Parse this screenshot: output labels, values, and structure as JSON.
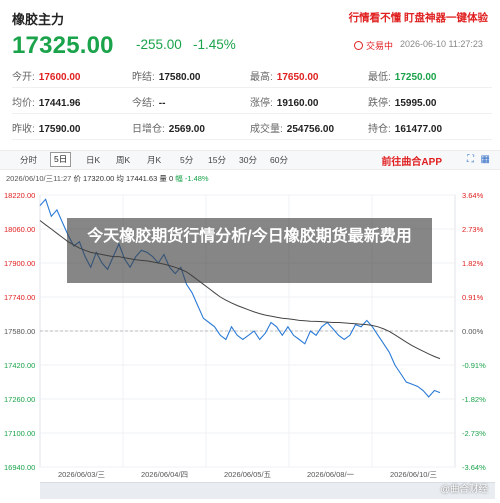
{
  "header": {
    "title": "橡胶主力",
    "promo": "行情看不懂 盯盘神器一键体验",
    "price": "17325.00",
    "change": "-255.00",
    "change_pct": "-1.45%",
    "status_label": "交易中",
    "status_time": "2026-06-10 11:27:23"
  },
  "stats": [
    [
      {
        "label": "今开:",
        "value": "17600.00",
        "color": "red"
      },
      {
        "label": "昨结:",
        "value": "17580.00",
        "color": "dark"
      },
      {
        "label": "最高:",
        "value": "17650.00",
        "color": "red"
      },
      {
        "label": "最低:",
        "value": "17250.00",
        "color": "green"
      }
    ],
    [
      {
        "label": "均价:",
        "value": "17441.96",
        "color": "dark"
      },
      {
        "label": "今结:",
        "value": "--",
        "color": "dark"
      },
      {
        "label": "涨停:",
        "value": "19160.00",
        "color": "dark"
      },
      {
        "label": "跌停:",
        "value": "15995.00",
        "color": "dark"
      }
    ],
    [
      {
        "label": "昨收:",
        "value": "17590.00",
        "color": "dark"
      },
      {
        "label": "日增仓:",
        "value": "2569.00",
        "color": "dark"
      },
      {
        "label": "成交量:",
        "value": "254756.00",
        "color": "dark"
      },
      {
        "label": "持仓:",
        "value": "161477.00",
        "color": "dark"
      }
    ]
  ],
  "tabs": [
    "分时",
    "5日",
    "日K",
    "周K",
    "月K",
    "5分",
    "15分",
    "30分",
    "60分"
  ],
  "active_tab": "5日",
  "tab_app": "前往曲合APP",
  "tab_icons": [
    "expand-icon",
    "grid-icon"
  ],
  "info_bar": {
    "datetime": "2026/06/10/三11:27",
    "price": "价 17320.00",
    "avg": "均 17441.63",
    "change": "量 0",
    "pct": "幅 -1.48%"
  },
  "overlay_text": "今天橡胶期货行情分析/今日橡胶期货最新费用",
  "watermark": "@曲合财经",
  "colors": {
    "up": "#e02020",
    "down": "#1aa34a",
    "price_line": "#2a7ad6",
    "avg_line": "#444444"
  },
  "chart_data": {
    "type": "line",
    "y_left_ticks": [
      "18220.00",
      "18060.00",
      "17900.00",
      "17740.00",
      "17580.00",
      "17420.00",
      "17260.00",
      "17100.00",
      "16940.00"
    ],
    "y_right_ticks": [
      "3.64%",
      "2.73%",
      "1.82%",
      "0.91%",
      "0.00%",
      "-0.91%",
      "-1.82%",
      "-2.73%",
      "-3.64%"
    ],
    "ylim": [
      16940,
      18220
    ],
    "x_labels": [
      "2026/06/03/三",
      "2026/06/04/四",
      "2026/06/05/五",
      "2026/06/08/一",
      "2026/06/10/三"
    ],
    "baseline": 17580,
    "series": [
      {
        "name": "价",
        "values": [
          18170,
          18200,
          18120,
          18150,
          18090,
          18030,
          17980,
          18000,
          17930,
          17880,
          17950,
          17900,
          17870,
          17930,
          17990,
          17920,
          17880,
          17930,
          17960,
          17950,
          17930,
          17900,
          17940,
          17880,
          17850,
          17880,
          17800,
          17760,
          17700,
          17640,
          17620,
          17600,
          17560,
          17540,
          17600,
          17560,
          17540,
          17560,
          17580,
          17540,
          17570,
          17620,
          17600,
          17560,
          17600,
          17560,
          17540,
          17520,
          17580,
          17560,
          17600,
          17620,
          17590,
          17560,
          17540,
          17560,
          17610,
          17600,
          17630,
          17600,
          17560,
          17520,
          17480,
          17420,
          17380,
          17340,
          17330,
          17320,
          17300,
          17270,
          17300,
          17290
        ]
      },
      {
        "name": "均",
        "values": [
          18100,
          18080,
          18060,
          18040,
          18020,
          18000,
          17985,
          17970,
          17960,
          17950,
          17945,
          17940,
          17935,
          17930,
          17930,
          17925,
          17920,
          17915,
          17912,
          17910,
          17905,
          17900,
          17895,
          17888,
          17880,
          17870,
          17858,
          17840,
          17820,
          17800,
          17780,
          17760,
          17740,
          17725,
          17712,
          17700,
          17690,
          17680,
          17670,
          17662,
          17655,
          17650,
          17645,
          17640,
          17638,
          17634,
          17630,
          17628,
          17626,
          17625,
          17624,
          17622,
          17620,
          17620,
          17618,
          17616,
          17614,
          17612,
          17610,
          17606,
          17600,
          17590,
          17578,
          17562,
          17545,
          17528,
          17512,
          17498,
          17485,
          17472,
          17460,
          17450
        ]
      }
    ]
  }
}
